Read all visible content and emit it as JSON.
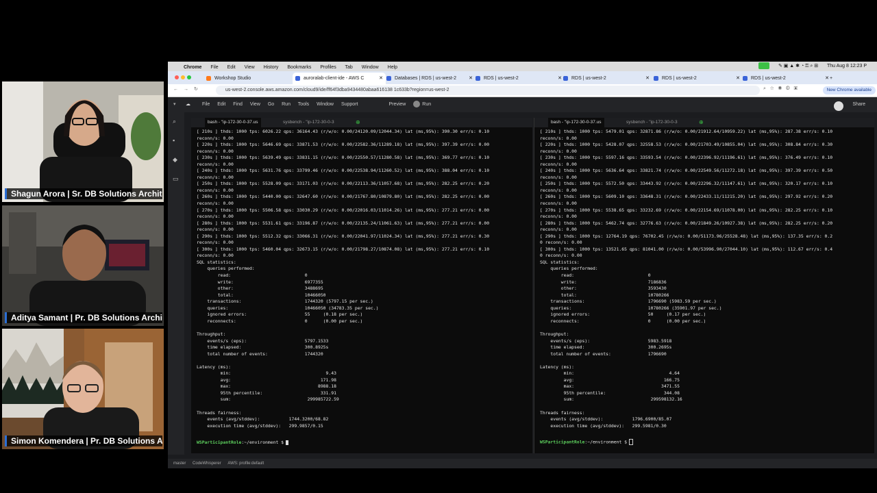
{
  "participants": [
    {
      "name": "Shagun Arora | Sr. DB Solutions Archit..."
    },
    {
      "name": "Aditya Samant | Pr. DB Solutions Archi..."
    },
    {
      "name": "Simon Komendera | Pr. DB Solutions A..."
    }
  ],
  "macos_menu": {
    "app": "Chrome",
    "items": [
      "File",
      "Edit",
      "View",
      "History",
      "Bookmarks",
      "Profiles",
      "Tab",
      "Window",
      "Help"
    ],
    "clock": "Thu Aug 8 12:23 P"
  },
  "browser": {
    "tabs": [
      "Workshop Studio",
      "auroralab-client-ide - AWS C",
      "Databases | RDS | us-west-2",
      "RDS | us-west-2",
      "RDS | us-west-2",
      "RDS | us-west-2",
      "RDS | us-west-2"
    ],
    "url": "us-west-2.console.aws.amazon.com/cloud9/ide/ff64f3dba9434480abaa616138 1c633b?region=us-west-2",
    "new_chrome": "New Chrome available"
  },
  "ide": {
    "menu": [
      "File",
      "Edit",
      "Find",
      "View",
      "Go",
      "Run",
      "Tools",
      "Window",
      "Support"
    ],
    "preview": "Preview",
    "run": "Run",
    "share": "Share",
    "status": [
      "master",
      "CodeWhisperer",
      "AWS: profile:default"
    ]
  },
  "left_pane": {
    "tabs": [
      "bash - \"ip-172-30-0-37.us",
      "sysbench - \"ip-172-30-0-3"
    ],
    "output": "[ 210s ] thds: 1000 tps: 6026.22 qps: 36164.43 (r/w/o: 0.00/24120.09/12044.34) lat (ms,95%): 390.30 err/s: 0.10\nreconn/s: 0.00\n[ 220s ] thds: 1000 tps: 5646.69 qps: 33871.53 (r/w/o: 0.00/22582.36/11289.18) lat (ms,95%): 397.39 err/s: 0.00\nreconn/s: 0.00\n[ 230s ] thds: 1000 tps: 5639.49 qps: 33831.15 (r/w/o: 0.00/22550.57/11280.58) lat (ms,95%): 369.77 err/s: 0.10\nreconn/s: 0.00\n[ 240s ] thds: 1000 tps: 5631.76 qps: 33799.46 (r/w/o: 0.00/22538.94/11260.52) lat (ms,95%): 388.04 err/s: 0.10\nreconn/s: 0.00\n[ 250s ] thds: 1000 tps: 5528.09 qps: 33171.03 (r/w/o: 0.00/22113.36/11057.68) lat (ms,95%): 282.25 err/s: 0.20\nreconn/s: 0.00\n[ 260s ] thds: 1000 tps: 5440.00 qps: 32647.60 (r/w/o: 0.00/21767.80/10879.80) lat (ms,95%): 282.25 err/s: 0.00\nreconn/s: 0.00\n[ 270s ] thds: 1000 tps: 5506.58 qps: 33030.29 (r/w/o: 0.00/22016.03/11014.26) lat (ms,95%): 277.21 err/s: 0.00\nreconn/s: 0.00\n[ 280s ] thds: 1000 tps: 5531.61 qps: 33196.87 (r/w/o: 0.00/22135.24/11061.63) lat (ms,95%): 277.21 err/s: 0.00\nreconn/s: 0.00\n[ 290s ] thds: 1000 tps: 5512.32 qps: 33066.31 (r/w/o: 0.00/22041.97/11024.34) lat (ms,95%): 277.21 err/s: 0.30\nreconn/s: 0.00\n[ 300s ] thds: 1000 tps: 5460.04 qps: 32673.15 (r/w/o: 0.00/21798.27/10874.08) lat (ms,95%): 277.21 err/s: 0.10\nreconn/s: 0.00\nSQL statistics:\n    queries performed:\n        read:                            0\n        write:                           6977355\n        other:                           3488695\n        total:                           10466050\n    transactions:                        1744320 (5797.15 per sec.)\n    queries:                             10466050 (34783.35 per sec.)\n    ignored errors:                      55     (0.18 per sec.)\n    reconnects:                          0      (0.00 per sec.)\n\nThroughput:\n    events/s (eps):                      5797.1533\n    time elapsed:                        300.8925s\n    total number of events:              1744320\n\nLatency (ms):\n         min:                                    9.43\n         avg:                                  171.98\n         max:                                 8988.18\n         95th percentile:                      331.91\n         sum:                             299985722.59\n\nThreads fairness:\n    events (avg/stddev):           1744.3200/68.82\n    execution time (avg/stddev):   299.9857/0.15",
    "prompt_role": "WSParticipantRole",
    "prompt_path": ":~/environment $"
  },
  "right_pane": {
    "tabs": [
      "bash - \"ip-172-30-0-37.us",
      "sysbench - \"ip-172-30-0-3"
    ],
    "output": "[ 210s ] thds: 1000 tps: 5479.01 qps: 32871.86 (r/w/o: 0.00/21912.64/10959.22) lat (ms,95%): 287.38 err/s: 0.10\nreconn/s: 0.00\n[ 220s ] thds: 1000 tps: 5428.07 qps: 32558.53 (r/w/o: 0.00/21703.49/10855.04) lat (ms,95%): 308.84 err/s: 0.30\nreconn/s: 0.00\n[ 230s ] thds: 1000 tps: 5597.16 qps: 33593.54 (r/w/o: 0.00/22396.92/11196.61) lat (ms,95%): 376.49 err/s: 0.10\nreconn/s: 0.00\n[ 240s ] thds: 1000 tps: 5636.64 qps: 33821.74 (r/w/o: 0.00/22549.56/11272.18) lat (ms,95%): 397.39 err/s: 0.50\nreconn/s: 0.00\n[ 250s ] thds: 1000 tps: 5572.50 qps: 33443.92 (r/w/o: 0.00/22296.32/11147.61) lat (ms,95%): 320.17 err/s: 0.10\nreconn/s: 0.00\n[ 260s ] thds: 1000 tps: 5609.10 qps: 33648.31 (r/w/o: 0.00/22433.11/11215.20) lat (ms,95%): 297.92 err/s: 0.20\nreconn/s: 0.00\n[ 270s ] thds: 1000 tps: 5538.65 qps: 33232.69 (r/w/o: 0.00/22154.69/11078.00) lat (ms,95%): 282.25 err/s: 0.10\nreconn/s: 0.00\n[ 280s ] thds: 1000 tps: 5462.74 qps: 32776.63 (r/w/o: 0.00/21849.26/10927.38) lat (ms,95%): 282.25 err/s: 0.20\nreconn/s: 0.00\n[ 290s ] thds: 1000 tps: 12764.19 qps: 76702.45 (r/w/o: 0.00/51173.96/25528.48) lat (ms,95%): 137.35 err/s: 0.2\n0 reconn/s: 0.00\n[ 300s ] thds: 1000 tps: 13521.65 qps: 81041.00 (r/w/o: 0.00/53996.90/27044.10) lat (ms,95%): 112.67 err/s: 0.4\n0 reconn/s: 0.00\nSQL statistics:\n    queries performed:\n        read:                            0\n        write:                           7186836\n        other:                           3593430\n        total:                           10780266\n    transactions:                        1796690 (5983.59 per sec.)\n    queries:                             10780266 (35901.97 per sec.)\n    ignored errors:                      50     (0.17 per sec.)\n    reconnects:                          0      (0.00 per sec.)\n\nThroughput:\n    events/s (eps):                      5983.5918\n    time elapsed:                        300.2695s\n    total number of events:              1796690\n\nLatency (ms):\n         min:                                    4.64\n         avg:                                  166.75\n         max:                                 3471.55\n         95th percentile:                      344.08\n         sum:                             299598132.16\n\nThreads fairness:\n    events (avg/stddev):           1796.6900/85.07\n    execution time (avg/stddev):   299.5981/0.30",
    "prompt_role": "WSParticipantRole",
    "prompt_path": ":~/environment $"
  }
}
